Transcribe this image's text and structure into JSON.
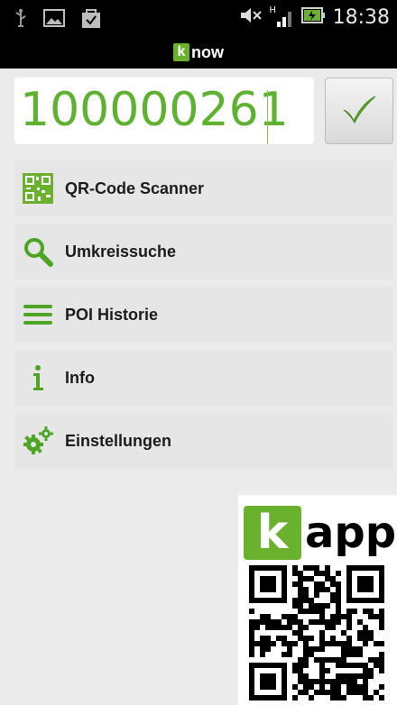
{
  "status_bar": {
    "time": "18:38",
    "icons": [
      "usb-icon",
      "image-icon",
      "bag-icon",
      "mute-icon",
      "signal-icon",
      "battery-icon"
    ],
    "network_label": "H"
  },
  "app": {
    "logo_k": "k",
    "logo_text": "now",
    "brand_color": "#6ab22e"
  },
  "code_input": {
    "value": "100000261",
    "value_color": "#5db230",
    "submit_icon": "checkmark-icon"
  },
  "menu": {
    "items": [
      {
        "label": "QR-Code Scanner",
        "icon": "qr-code-icon"
      },
      {
        "label": "Umkreissuche",
        "icon": "search-icon"
      },
      {
        "label": "POI Historie",
        "icon": "list-icon"
      },
      {
        "label": "Info",
        "icon": "info-icon"
      },
      {
        "label": "Einstellungen",
        "icon": "gears-icon"
      }
    ]
  },
  "promo": {
    "logo_k": "k",
    "logo_text": "app"
  }
}
